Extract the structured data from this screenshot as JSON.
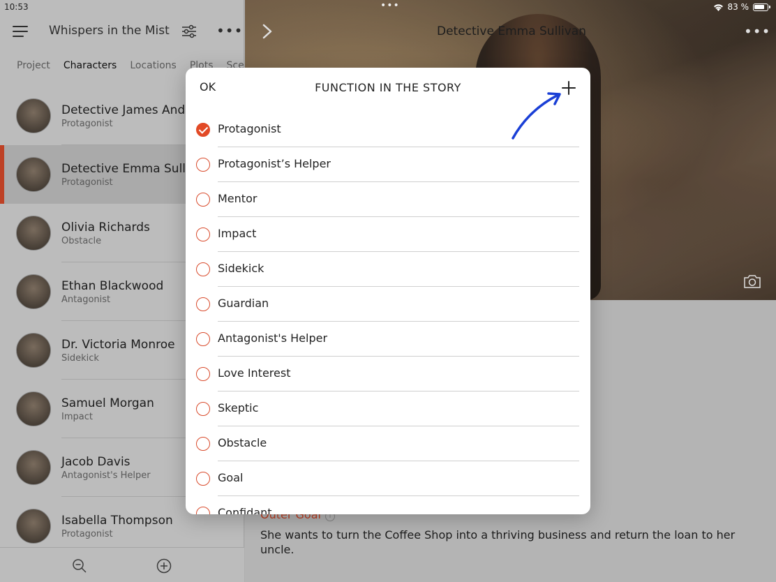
{
  "status_bar": {
    "time": "10:53",
    "battery": "83 %"
  },
  "sidebar": {
    "project_title": "Whispers in the Mist",
    "tabs": [
      "Project",
      "Characters",
      "Locations",
      "Plots",
      "Sce"
    ],
    "characters": [
      {
        "name": "Detective James And",
        "role": "Protagonist"
      },
      {
        "name": "Detective Emma Sull",
        "role": "Protagonist"
      },
      {
        "name": "Olivia Richards",
        "role": "Obstacle"
      },
      {
        "name": "Ethan Blackwood",
        "role": "Antagonist"
      },
      {
        "name": "Dr. Victoria Monroe",
        "role": "Sidekick"
      },
      {
        "name": "Samuel Morgan",
        "role": "Impact"
      },
      {
        "name": "Jacob Davis",
        "role": "Antagonist's Helper"
      },
      {
        "name": "Isabella Thompson",
        "role": "Protagonist"
      }
    ],
    "selected_index": 1
  },
  "detail": {
    "title": "Detective Emma Sullivan",
    "outer_goal_label": "Outer Goal",
    "outer_goal_text": "She wants to turn the Coffee Shop into a thriving business and return the loan to her uncle."
  },
  "modal": {
    "ok_label": "OK",
    "title": "FUNCTION IN THE STORY",
    "options": [
      {
        "label": "Protagonist",
        "checked": true
      },
      {
        "label": "Protagonist’s Helper",
        "checked": false
      },
      {
        "label": "Mentor",
        "checked": false
      },
      {
        "label": "Impact",
        "checked": false
      },
      {
        "label": "Sidekick",
        "checked": false
      },
      {
        "label": "Guardian",
        "checked": false
      },
      {
        "label": "Antagonist's Helper",
        "checked": false
      },
      {
        "label": "Love Interest",
        "checked": false
      },
      {
        "label": "Skeptic",
        "checked": false
      },
      {
        "label": "Obstacle",
        "checked": false
      },
      {
        "label": "Goal",
        "checked": false
      },
      {
        "label": "Confidant",
        "checked": false
      }
    ]
  },
  "colors": {
    "accent": "#e24a26",
    "annotation": "#1a3fd6"
  },
  "icons": [
    "menu-icon",
    "sliders-icon",
    "more-icon",
    "chevron-right-icon",
    "camera-icon",
    "zoom-out-icon",
    "plus-circle-icon",
    "plus-icon",
    "wifi-icon",
    "battery-icon"
  ]
}
